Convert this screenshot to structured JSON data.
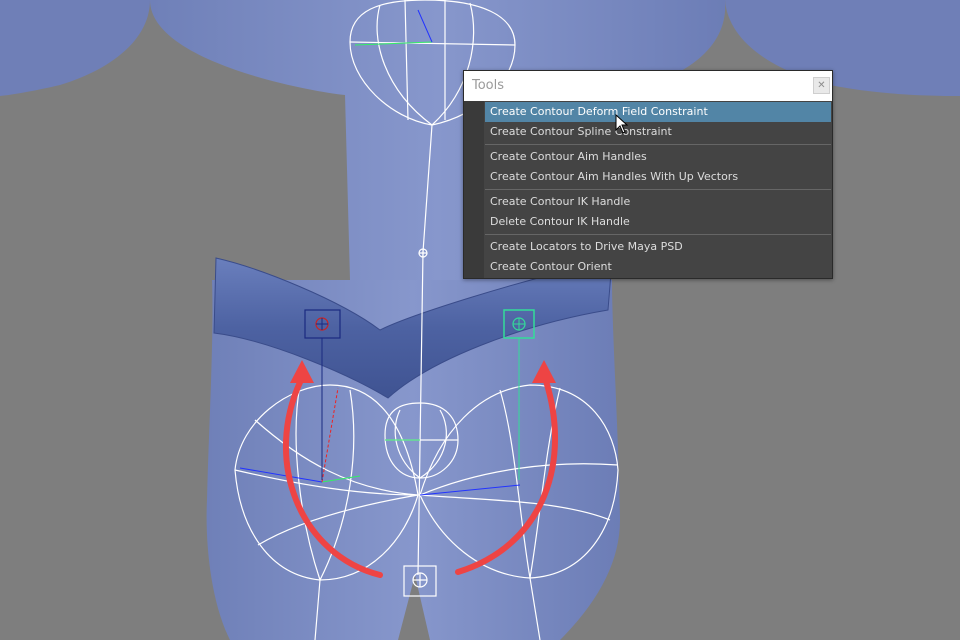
{
  "tools_window": {
    "title": "Tools",
    "close_icon": "close-icon",
    "groups": [
      [
        {
          "label": "Create Contour Deform Field Constraint",
          "selected": true
        },
        {
          "label": "Create Contour Spline Constraint",
          "selected": false
        }
      ],
      [
        {
          "label": "Create Contour Aim Handles",
          "selected": false
        },
        {
          "label": "Create Contour Aim Handles With Up Vectors",
          "selected": false
        }
      ],
      [
        {
          "label": "Create Contour IK Handle",
          "selected": false
        },
        {
          "label": "Delete Contour IK Handle",
          "selected": false
        }
      ],
      [
        {
          "label": "Create Locators to Drive Maya PSD",
          "selected": false
        },
        {
          "label": "Create Contour Orient",
          "selected": false
        }
      ]
    ]
  },
  "viewport": {
    "background": "#7e7e7e",
    "body_color": "#7d8dc4",
    "belt_color": "#5469a8",
    "arrow_color": "#ee4444",
    "wireframe_color": "#ffffff",
    "left_locator_color": "#1a2a80",
    "right_locator_color": "#33dd99"
  }
}
